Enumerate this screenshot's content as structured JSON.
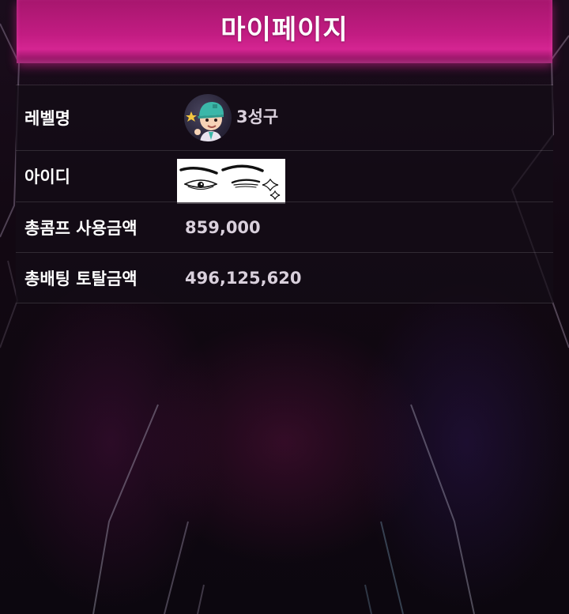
{
  "header": {
    "title": "마이페이지"
  },
  "rows": {
    "level": {
      "label": "레벨명",
      "value": "3성구"
    },
    "id": {
      "label": "아이디"
    },
    "comp_total": {
      "label": "총콤프 사용금액",
      "value": "859,000"
    },
    "bet_total": {
      "label": "총배팅 토탈금액",
      "value": "496,125,620"
    }
  },
  "colors": {
    "header_magenta": "#c21c82",
    "background": "#120812",
    "row_text": "#d9d0dc"
  },
  "icons": {
    "avatar": "level-character-avatar",
    "id_image": "sparkling-eyes-drawing"
  }
}
